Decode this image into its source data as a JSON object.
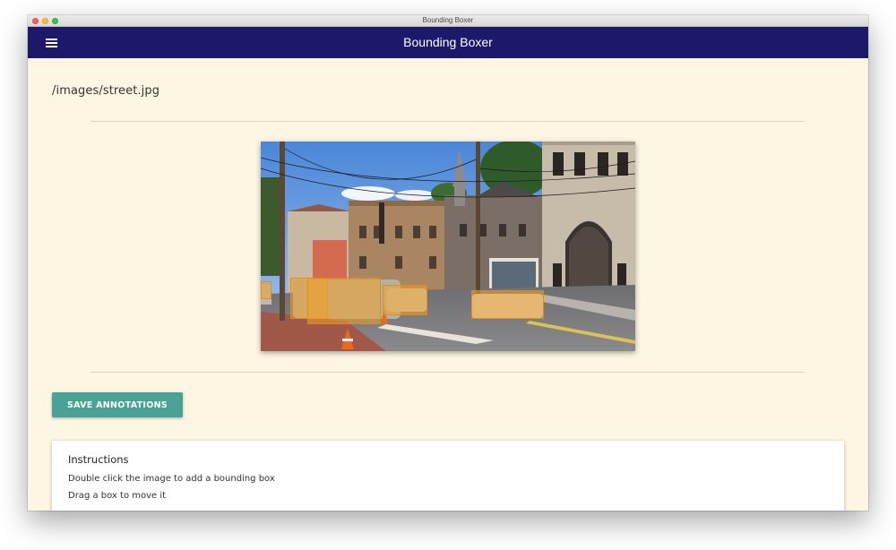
{
  "window": {
    "title": "Bounding Boxer"
  },
  "appbar": {
    "title": "Bounding Boxer",
    "menu_icon": "hamburger-menu-icon"
  },
  "file": {
    "path": "/images/street.jpg"
  },
  "image": {
    "description_icon": "street-photo"
  },
  "annotations": {
    "count": 5,
    "box_color": "#f0a028"
  },
  "actions": {
    "save_label": "SAVE ANNOTATIONS"
  },
  "instructions": {
    "title": "Instructions",
    "steps": [
      "Double click the image to add a bounding box",
      "Drag a box to move it"
    ]
  },
  "colors": {
    "appbar": "#1e186a",
    "background": "#fdf6e3",
    "accent": "#4aa296"
  }
}
